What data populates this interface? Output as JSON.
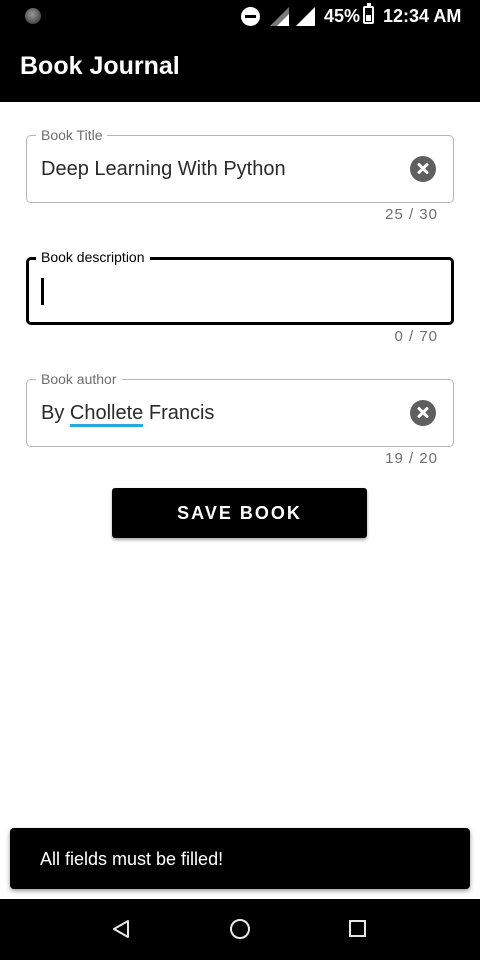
{
  "status_bar": {
    "battery_percent": "45%",
    "battery_level": 0.45,
    "time": "12:34 AM",
    "icons": [
      "camera-icon",
      "do-not-disturb-icon",
      "signal-icon",
      "wifi-signal-icon",
      "battery-icon"
    ]
  },
  "app_bar": {
    "title": "Book Journal"
  },
  "form": {
    "title_field": {
      "label": "Book Title",
      "value": "Deep Learning With Python",
      "counter": "25 / 30"
    },
    "description_field": {
      "label": "Book description",
      "value": "",
      "counter": "0 / 70"
    },
    "author_field": {
      "label": "Book author",
      "value_prefix": "By ",
      "value_underlined": "Chollete",
      "value_suffix": " Francis",
      "counter": "19 / 20"
    },
    "save_label": "SAVE BOOK"
  },
  "snackbar": {
    "message": "All fields must be filled!"
  },
  "nav_bar": {
    "icons": [
      "back-icon",
      "home-icon",
      "recents-icon"
    ]
  },
  "colors": {
    "app_bar": "#000000",
    "spell_underline": "#26a9e0",
    "clear_icon": "#5f5f5f"
  }
}
